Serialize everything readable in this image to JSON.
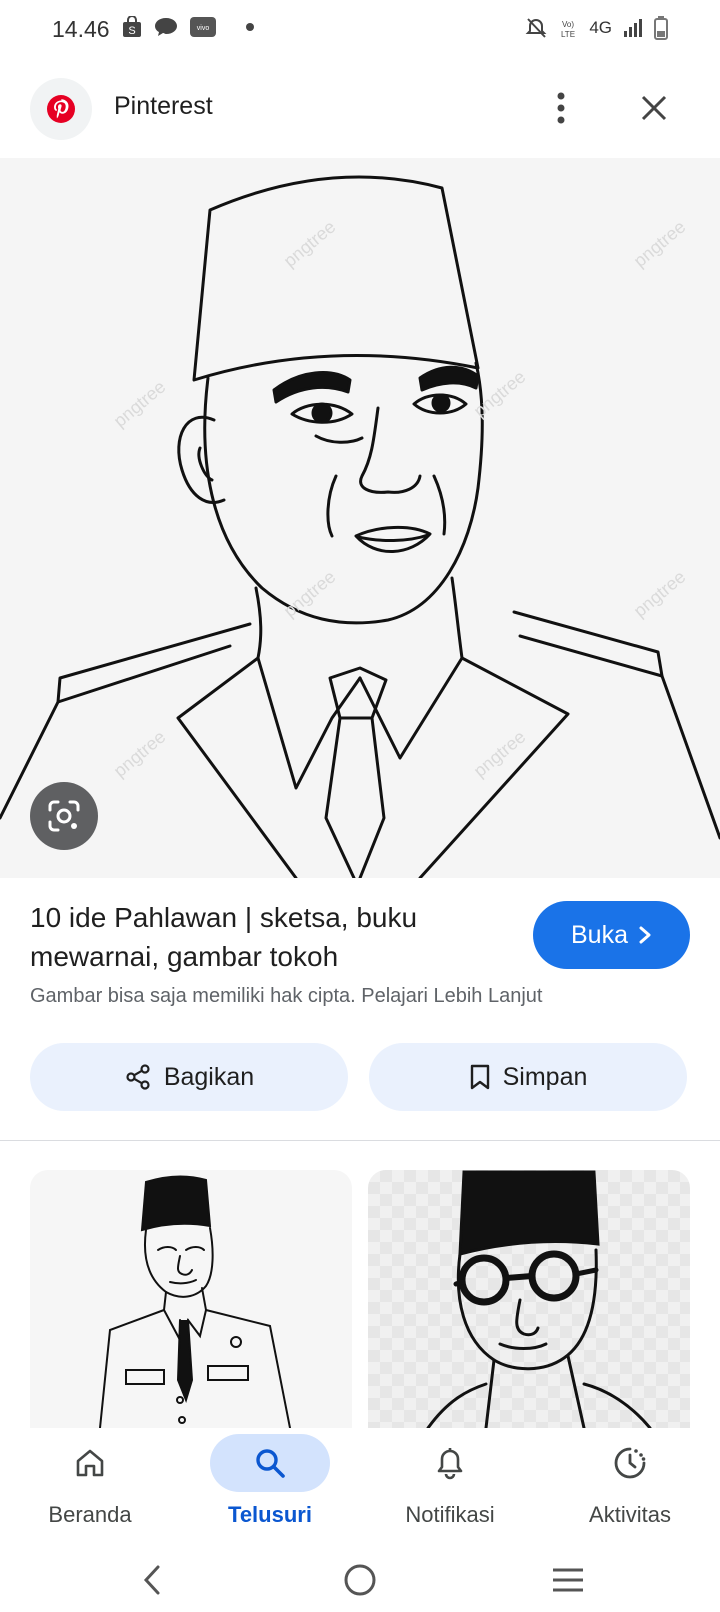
{
  "status_bar": {
    "time": "14.46",
    "network_text": "4G"
  },
  "header": {
    "source_name": "Pinterest",
    "logo_color": "#e60023"
  },
  "result": {
    "title": "10 ide Pahlawan | sketsa, buku mewarnai, gambar tokoh",
    "open_label": "Buka",
    "copyright_note": "Gambar bisa saja memiliki hak cipta. Pelajari Lebih Lanjut",
    "share_label": "Bagikan",
    "save_label": "Simpan",
    "accent_color": "#1a73e8"
  },
  "bottom_nav": {
    "items": [
      {
        "label": "Beranda",
        "icon": "home-icon"
      },
      {
        "label": "Telusuri",
        "icon": "search-icon",
        "active": true
      },
      {
        "label": "Notifikasi",
        "icon": "bell-icon"
      },
      {
        "label": "Aktivitas",
        "icon": "activity-icon"
      }
    ]
  }
}
